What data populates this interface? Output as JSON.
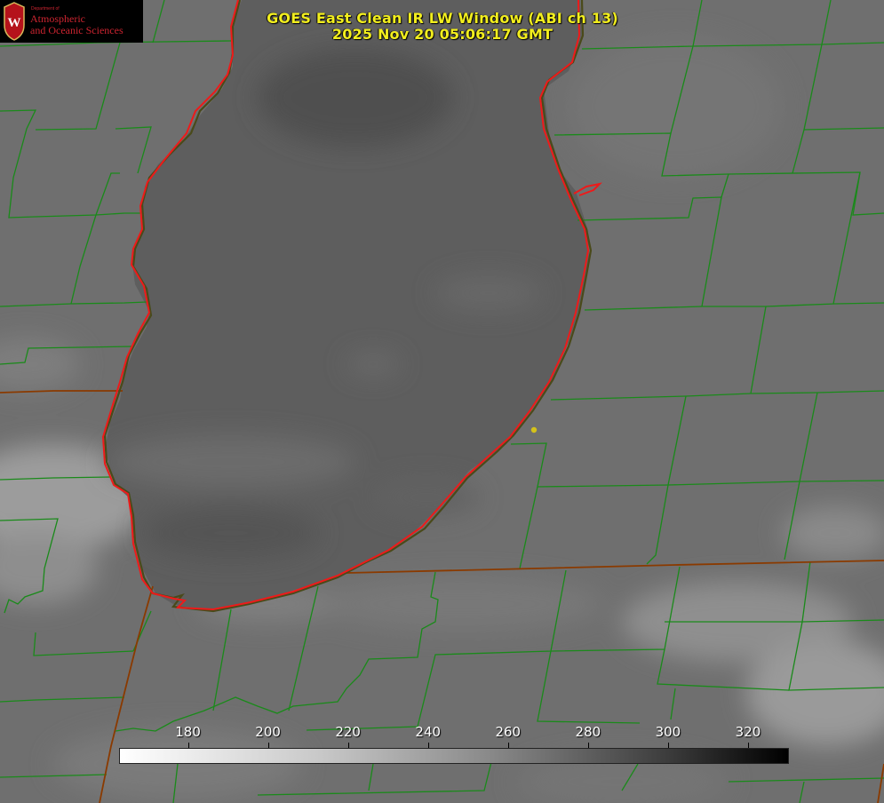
{
  "title": {
    "line1": "GOES East Clean IR LW Window (ABI ch 13)",
    "line2": "2025 Nov 20 05:06:17 GMT"
  },
  "logo": {
    "dept": "Department of",
    "line1": "Atmospheric",
    "line2": "and Oceanic Sciences",
    "crest_letter": "W"
  },
  "colorbar": {
    "ticks": [
      "180",
      "200",
      "220",
      "240",
      "260",
      "280",
      "300",
      "320"
    ],
    "tick_values": [
      180,
      200,
      220,
      240,
      260,
      280,
      300,
      320
    ],
    "range": [
      163,
      330
    ]
  },
  "colors": {
    "title": "#f2ee1e",
    "county_lines": "#1a8a1a",
    "state_lines": "#8a3a00",
    "lake_outline": "#ee1a1a",
    "marker": "#d4c21a"
  }
}
